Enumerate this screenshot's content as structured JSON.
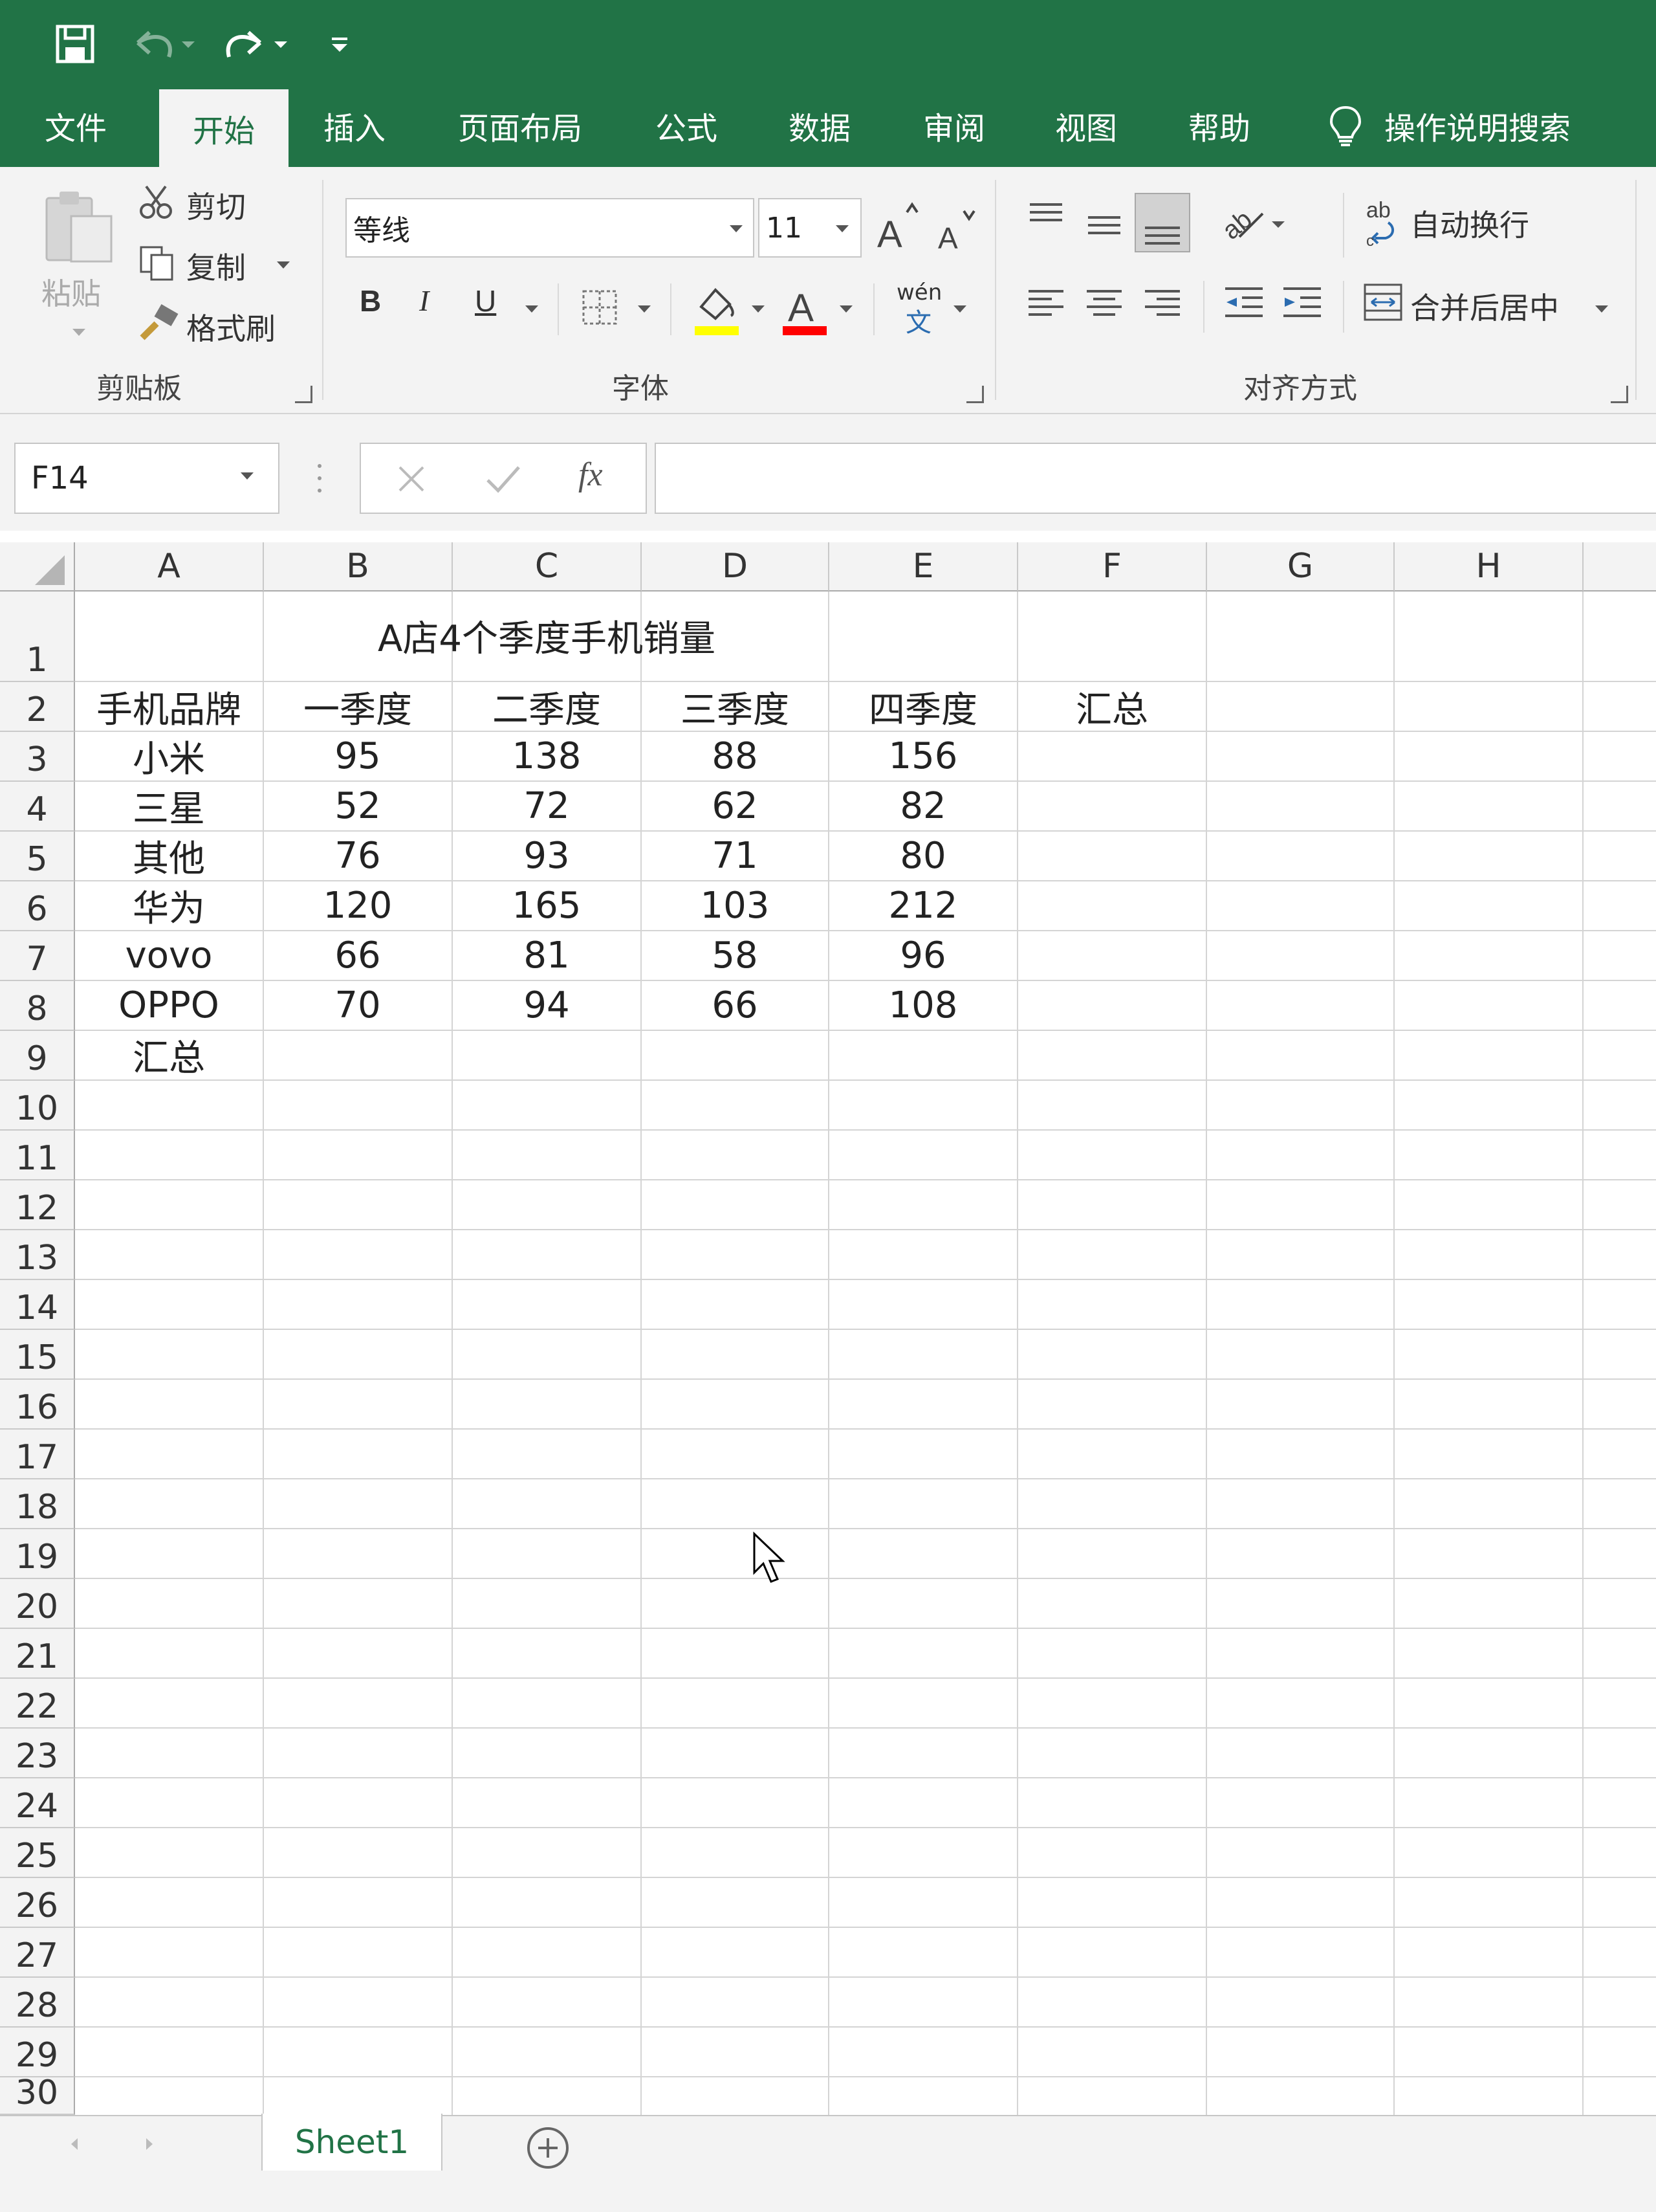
{
  "quick_access": {
    "save_icon": "save-icon",
    "undo_icon": "undo-icon",
    "redo_icon": "redo-icon",
    "customize_icon": "customize-icon"
  },
  "tabs": [
    {
      "label": "文件",
      "active": false
    },
    {
      "label": "开始",
      "active": true
    },
    {
      "label": "插入",
      "active": false
    },
    {
      "label": "页面布局",
      "active": false
    },
    {
      "label": "公式",
      "active": false
    },
    {
      "label": "数据",
      "active": false
    },
    {
      "label": "审阅",
      "active": false
    },
    {
      "label": "视图",
      "active": false
    },
    {
      "label": "帮助",
      "active": false
    }
  ],
  "tell_me": "操作说明搜索",
  "ribbon": {
    "clipboard": {
      "paste": "粘贴",
      "cut": "剪切",
      "copy": "复制",
      "format_painter": "格式刷",
      "group": "剪贴板"
    },
    "font": {
      "name": "等线",
      "size": "11",
      "bold": "B",
      "italic": "I",
      "underline": "U",
      "wen": "wén",
      "wen_sub": "文",
      "group": "字体",
      "fill_color": "#ffff00",
      "font_color": "#ff0000"
    },
    "alignment": {
      "wrap": "自动换行",
      "merge": "合并后居中",
      "group": "对齐方式"
    }
  },
  "formula_bar": {
    "name_box": "F14",
    "fx": "fx",
    "formula": ""
  },
  "columns": [
    "A",
    "B",
    "C",
    "D",
    "E",
    "F",
    "G",
    "H"
  ],
  "rows": [
    "1",
    "2",
    "3",
    "4",
    "5",
    "6",
    "7",
    "8",
    "9",
    "10",
    "11",
    "12",
    "13",
    "14",
    "15",
    "16",
    "17",
    "18",
    "19",
    "20",
    "21",
    "22",
    "23",
    "24",
    "25",
    "26",
    "27",
    "28",
    "29",
    "30"
  ],
  "sheet": {
    "title": "A店4个季度手机销量",
    "headers": [
      "手机品牌",
      "一季度",
      "二季度",
      "三季度",
      "四季度",
      "汇总"
    ],
    "data": [
      [
        "小米",
        "95",
        "138",
        "88",
        "156"
      ],
      [
        "三星",
        "52",
        "72",
        "62",
        "82"
      ],
      [
        "其他",
        "76",
        "93",
        "71",
        "80"
      ],
      [
        "华为",
        "120",
        "165",
        "103",
        "212"
      ],
      [
        "vovo",
        "66",
        "81",
        "58",
        "96"
      ],
      [
        "OPPO",
        "70",
        "94",
        "66",
        "108"
      ]
    ],
    "total_label": "汇总"
  },
  "sheet_tabs": {
    "active": "Sheet1"
  },
  "colors": {
    "excel_green": "#217346",
    "ribbon_bg": "#f3f3f3"
  }
}
